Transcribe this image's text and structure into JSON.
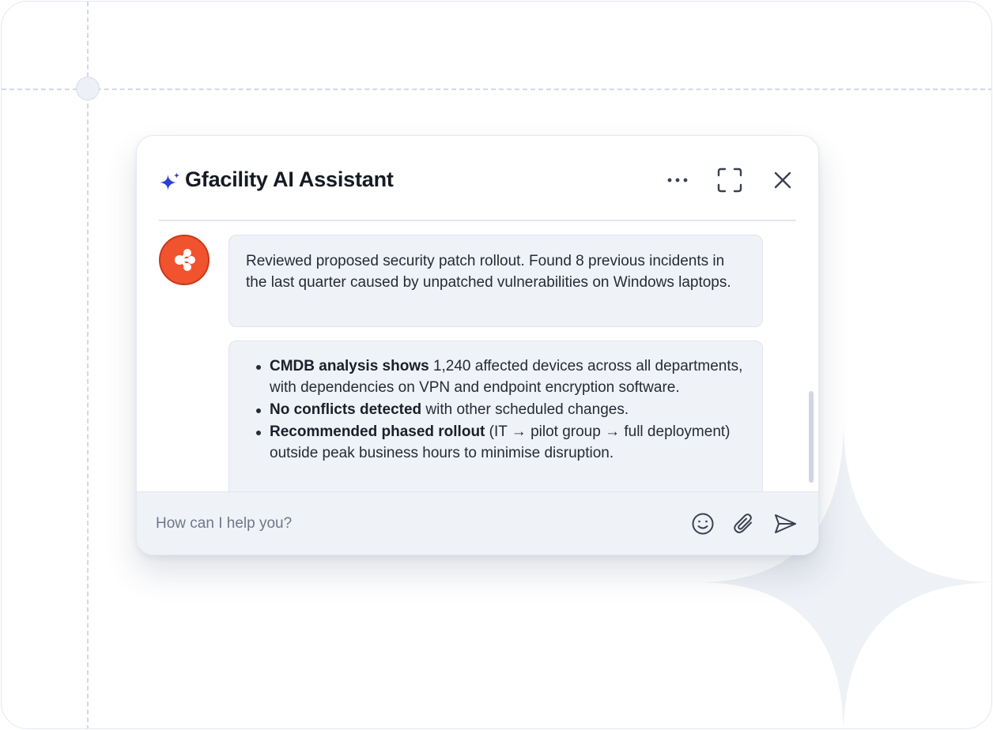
{
  "assistant": {
    "title": "Gfacility AI Assistant",
    "accent_color": "#2b3fd6",
    "avatar_color": "#f0532d"
  },
  "header_actions": {
    "more_icon": "ellipsis-icon",
    "expand_icon": "expand-icon",
    "close_icon": "close-icon"
  },
  "messages": {
    "first": "Reviewed proposed security patch rollout. Found 8 previous incidents in the last quarter caused by unpatched vulnerabilities on Windows laptops.",
    "bullets": [
      {
        "bold": "CMDB analysis shows",
        "text": " 1,240 affected devices across all departments, with dependencies on VPN and endpoint encryption software."
      },
      {
        "bold": "No conflicts detected",
        "text": " with other scheduled changes."
      },
      {
        "bold": "Recommended phased rollout",
        "text": " (IT → pilot group → full deployment) outside peak business hours to minimise disruption."
      }
    ]
  },
  "composer": {
    "placeholder": "How can I help you?",
    "emoji_icon": "smiley-icon",
    "attach_icon": "paperclip-icon",
    "send_icon": "send-icon"
  }
}
